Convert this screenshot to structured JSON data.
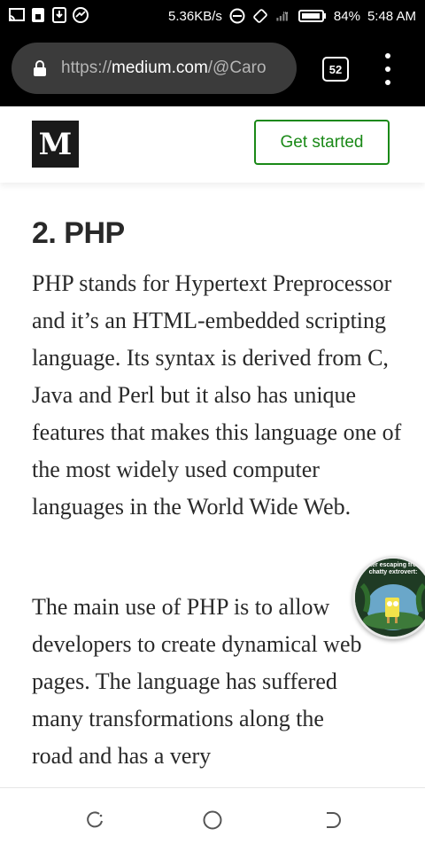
{
  "status_bar": {
    "net_speed": "5.36KB/s",
    "battery": "84%",
    "time": "5:48 AM",
    "icons": [
      "cast-icon",
      "lock-icon",
      "download-icon",
      "messenger-icon",
      "dnd-icon",
      "rotate-icon",
      "signal-icon",
      "battery-icon"
    ]
  },
  "browser": {
    "url_scheme": "https://",
    "url_host": "medium.com",
    "url_path": "/@Caro",
    "tab_count": "52"
  },
  "header": {
    "logo_text": "M",
    "cta_label": "Get started",
    "accent_color": "#1a8917"
  },
  "article": {
    "heading": "2. PHP",
    "paragraph1": "PHP stands for Hypertext Preprocessor and it’s an HTML-embedded scripting language. Its syntax is derived from C, Java and Perl but it also has unique features that makes this language one of the most widely used computer languages in the World Wide Web.",
    "paragraph2": "The main use of PHP is to allow developers to create dynamical web pages. The language has suffered many transformations along the road and has a very"
  },
  "bubble": {
    "caption": "after escaping from chatty extrovert:"
  },
  "nav": {
    "icons": [
      "recents-icon",
      "home-icon",
      "back-icon"
    ]
  }
}
